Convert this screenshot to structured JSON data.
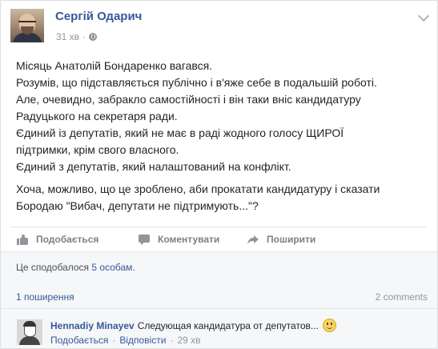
{
  "post": {
    "author": "Сергій Одарич",
    "time": "31 хв",
    "separator": "·",
    "paragraphs": [
      "Місяць Анатолій Бондаренко вагався.",
      "Розумів, що підставляється публічно і в'яже себе в подальшій роботі.",
      "Але, очевидно, забракло самостійності і він таки вніс кандидатуру",
      "Радуцького на секретаря ради.",
      "Єдиний із депутатів, який не має в раді жодного голосу ЩИРОЇ",
      "підтримки, крім свого власного.",
      "Єдиний з депутатів, який налаштований на конфлікт."
    ],
    "paragraph2": [
      "Хоча, можливо, що це зроблено, аби прокатати кандидатуру і сказати",
      "Бородаю \"Вибач, депутати не підтримують...\"?"
    ]
  },
  "actions": {
    "like": "Подобається",
    "comment": "Коментувати",
    "share": "Поширити"
  },
  "likes": {
    "prefix": "Це сподобалося",
    "link": "5 особам",
    "suffix": "."
  },
  "shares": {
    "link": "1 поширення",
    "comments": "2 comments"
  },
  "comment": {
    "author": "Hennadiy Minayev",
    "text": "Следующая кандидатура от депутатов...",
    "like": "Подобається",
    "reply": "Відповісти",
    "time": "29 хв",
    "separator": "·"
  },
  "icons": {
    "post_menu": "chevron-down-icon",
    "audience": "globe-icon",
    "like": "like-icon",
    "comment": "comment-icon",
    "share": "share-icon",
    "emoji": "smiley-emoji-icon"
  },
  "colors": {
    "link": "#365899",
    "muted": "#90949c",
    "background": "#f6f7f9"
  }
}
